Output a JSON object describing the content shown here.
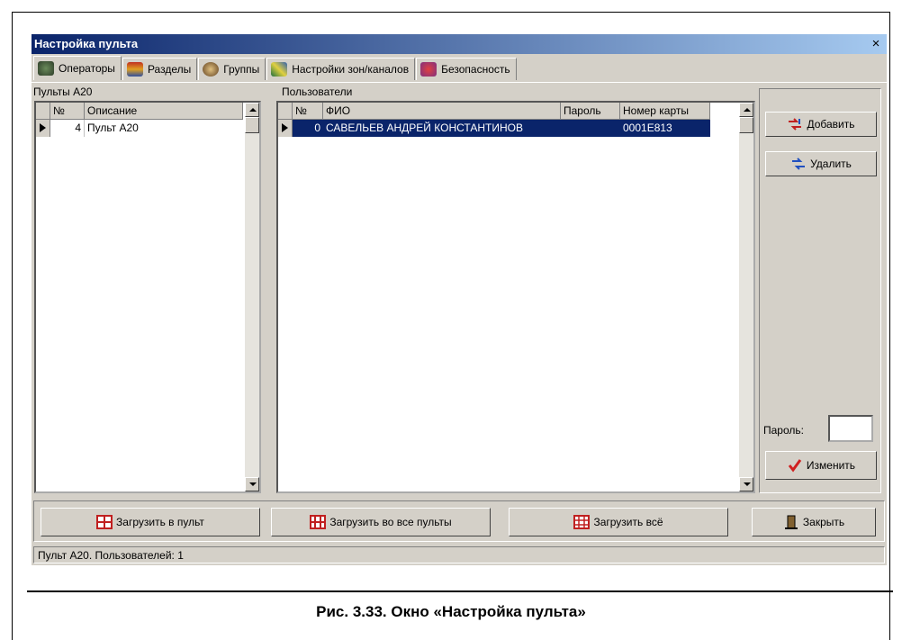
{
  "window": {
    "title": "Настройка пульта",
    "close_glyph": "×"
  },
  "tabs": [
    {
      "label": "Операторы",
      "icon": "operators-icon",
      "active": true
    },
    {
      "label": "Разделы",
      "icon": "sections-icon"
    },
    {
      "label": "Группы",
      "icon": "groups-icon"
    },
    {
      "label": "Настройки зон/каналов",
      "icon": "zones-icon"
    },
    {
      "label": "Безопасность",
      "icon": "security-icon"
    }
  ],
  "panels": {
    "left": {
      "label": "Пульты А20",
      "columns": [
        "№",
        "Описание"
      ],
      "rows": [
        {
          "num": "4",
          "desc": "Пульт А20"
        }
      ]
    },
    "middle": {
      "label": "Пользователи",
      "columns": [
        "№",
        "ФИО",
        "Пароль",
        "Номер карты"
      ],
      "rows": [
        {
          "num": "0",
          "fio": "САВЕЛЬЕВ АНДРЕЙ КОНСТАНТИНОВ",
          "password": "",
          "card": "0001E813"
        }
      ]
    }
  },
  "actions": {
    "add": "Добавить",
    "delete": "Удалить",
    "password_label": "Пароль:",
    "password_value": "",
    "change": "Изменить"
  },
  "bottom": {
    "load_to_panel": "Загрузить в пульт",
    "load_to_all": "Загрузить во все пульты",
    "load_all": "Загрузить всё",
    "close": "Закрыть"
  },
  "status": "Пульт А20. Пользователей: 1",
  "caption": "Рис. 3.33. Окно «Настройка пульта»",
  "colors": {
    "title_start": "#0a246a",
    "title_end": "#a6caf0",
    "selection": "#0a246a",
    "face": "#d4d0c8"
  }
}
